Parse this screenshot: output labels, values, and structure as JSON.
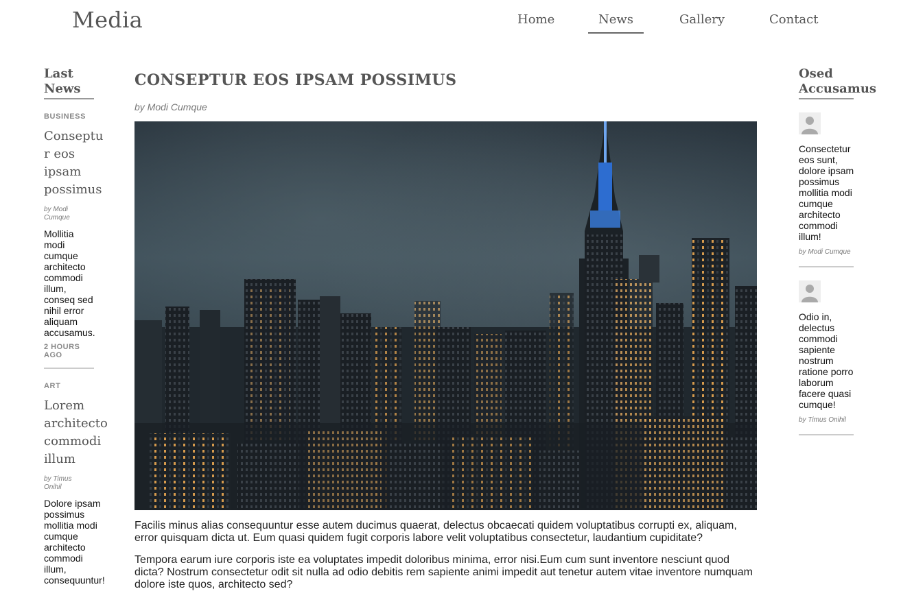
{
  "header": {
    "logo": "Media",
    "nav": [
      {
        "label": "Home",
        "active": false
      },
      {
        "label": "News",
        "active": true
      },
      {
        "label": "Gallery",
        "active": false
      },
      {
        "label": "Contact",
        "active": false
      }
    ]
  },
  "left": {
    "title": "Last News",
    "items": [
      {
        "category": "BUSINESS",
        "headline": "Conseptur eos ipsam possimus",
        "byline": "by Modi Cumque",
        "excerpt": "Mollitia modi cumque architecto commodi illum, conseq sed nihil error aliquam accusamus.",
        "time": "2 HOURS AGO"
      },
      {
        "category": "ART",
        "headline": "Lorem architecto commodi illum",
        "byline": "by Timus Onihil",
        "excerpt": "Dolore ipsam possimus mollitia modi cumque architecto commodi illum, consequuntur!"
      }
    ]
  },
  "article": {
    "title": "CONSEPTUR EOS IPSAM POSSIMUS",
    "byline": "by Modi Cumque",
    "image_alt": "city-skyline-at-night",
    "paragraphs": [
      "Facilis minus alias consequuntur esse autem ducimus quaerat, delectus obcaecati quidem voluptatibus corrupti ex, aliquam, error quisquam dicta ut. Eum quasi quidem fugit corporis labore velit voluptatibus consectetur, laudantium cupiditate?",
      "Tempora earum iure corporis iste ea voluptates impedit doloribus minima, error nisi.Eum cum sunt inventore nesciunt quod dicta? Nostrum consectetur odit sit nulla ad odio debitis rem sapiente animi impedit aut tenetur autem vitae inventore numquam dolore iste quos, architecto sed?"
    ]
  },
  "right": {
    "title": "Osed Accusamus",
    "comments": [
      {
        "text": "Consectetur eos sunt, dolore ipsam possimus mollitia modi cumque architecto commodi illum!",
        "byline": "by Modi Cumque"
      },
      {
        "text": "Odio in, delectus commodi sapiente nostrum ratione porro laborum facere quasi cumque!",
        "byline": "by Timus Onihil"
      }
    ]
  }
}
